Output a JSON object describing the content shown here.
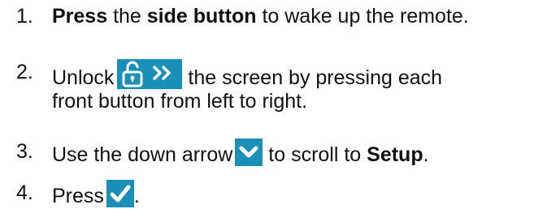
{
  "steps": [
    {
      "number": "1.",
      "parts": [
        {
          "text": "Press",
          "bold": true
        },
        {
          "text": " the ",
          "bold": false
        },
        {
          "text": "side button",
          "bold": true
        },
        {
          "text": " to wake up the remote.",
          "bold": false
        }
      ]
    },
    {
      "number": "2.",
      "line1_before_icon": "Unlock",
      "icon": "unlock-forward-icon",
      "line1_after_icon": " the screen by pressing each",
      "line2": "front button from left to right."
    },
    {
      "number": "3.",
      "before_icon": "Use the down arrow",
      "icon": "chevron-down-icon",
      "middle": " to scroll to ",
      "bold_word": "Setup",
      "after": "."
    },
    {
      "number": "4.",
      "before_icon": "Press",
      "icon": "checkmark-icon",
      "after": "."
    }
  ],
  "colors": {
    "icon_background": "#1b8fb8",
    "icon_foreground": "#ffffff",
    "text": "#111111"
  }
}
